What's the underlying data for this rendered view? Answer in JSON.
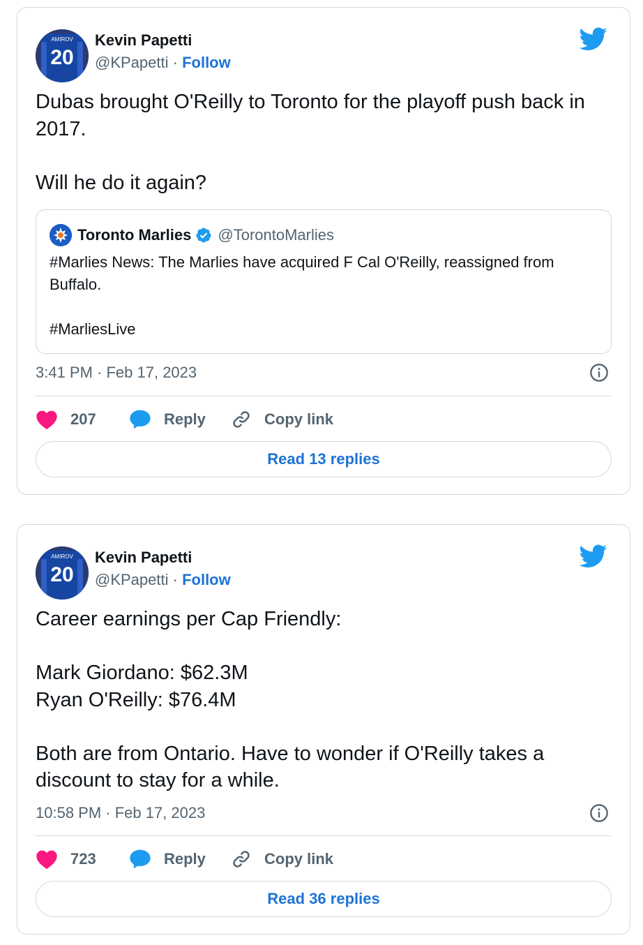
{
  "tweets": [
    {
      "author_name": "Kevin Papetti",
      "author_handle": "@KPapetti",
      "separator": "·",
      "follow_label": "Follow",
      "avatar_text": "20",
      "avatar_nameplate": "AMIROV",
      "text": "Dubas brought O'Reilly to Toronto for the playoff push back in 2017.\n\nWill he do it again?",
      "quote": {
        "name": "Toronto Marlies",
        "handle": "@TorontoMarlies",
        "text": "#Marlies News: The Marlies have acquired F Cal O'Reilly, reassigned from Buffalo.\n\n#MarliesLive"
      },
      "timestamp": "3:41 PM · Feb 17, 2023",
      "likes": "207",
      "reply_label": "Reply",
      "copy_link_label": "Copy link",
      "read_replies_label": "Read 13 replies"
    },
    {
      "author_name": "Kevin Papetti",
      "author_handle": "@KPapetti",
      "separator": "·",
      "follow_label": "Follow",
      "avatar_text": "20",
      "avatar_nameplate": "AMIROV",
      "text": "Career earnings per Cap Friendly:\n\nMark Giordano: $62.3M\nRyan O'Reilly: $76.4M\n\nBoth are from Ontario. Have to wonder if O'Reilly takes  a discount to stay for a while.",
      "timestamp": "10:58 PM · Feb 17, 2023",
      "likes": "723",
      "reply_label": "Reply",
      "copy_link_label": "Copy link",
      "read_replies_label": "Read 36 replies"
    }
  ],
  "colors": {
    "heart": "#f91880",
    "reply_bubble": "#1d9bf0",
    "twitter_blue": "#1d9bf0",
    "link_blue": "#1d72d6",
    "muted": "#536471",
    "border": "#cfd9de"
  },
  "icons": [
    "twitter-bird-icon",
    "heart-icon",
    "reply-bubble-icon",
    "link-icon",
    "info-icon",
    "verified-badge-icon"
  ]
}
